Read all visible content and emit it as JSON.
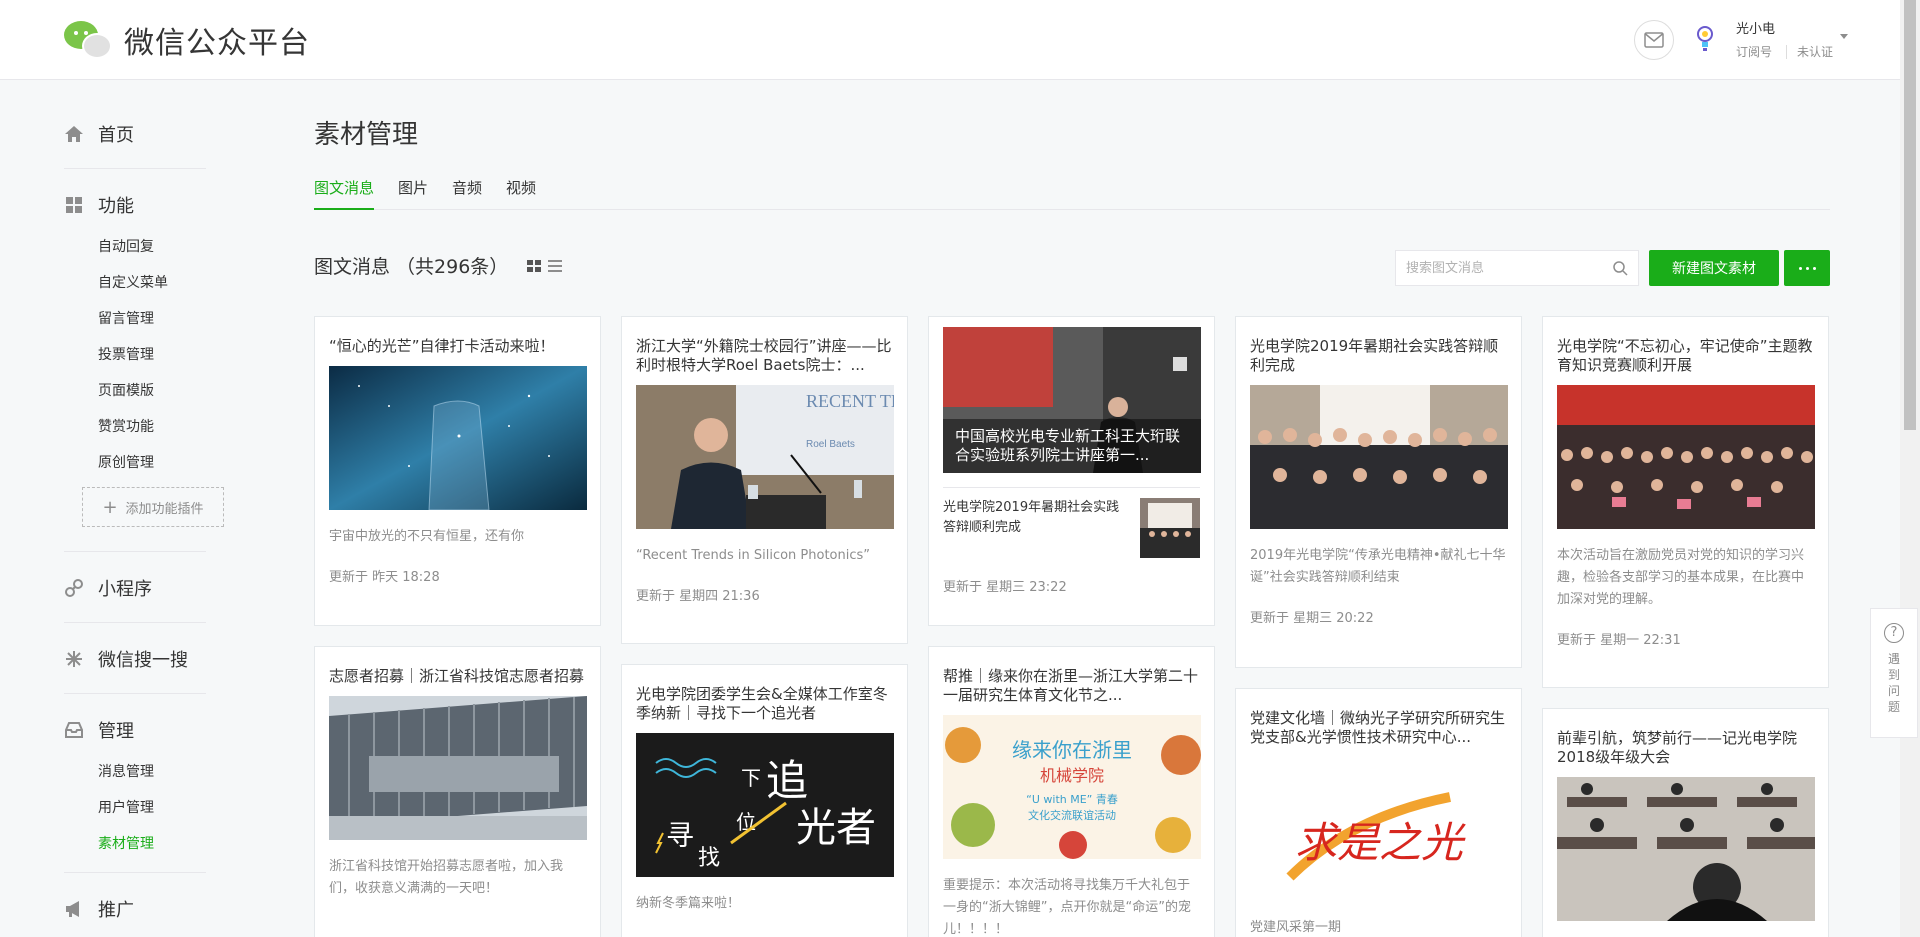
{
  "header": {
    "app_title": "微信公众平台",
    "account_name": "光小电",
    "account_type": "订阅号",
    "account_status": "未认证"
  },
  "sidebar": {
    "groups": [
      {
        "label": "首页",
        "icon": "home-icon",
        "items": []
      },
      {
        "label": "功能",
        "icon": "grid-icon",
        "items": [
          "自动回复",
          "自定义菜单",
          "留言管理",
          "投票管理",
          "页面模版",
          "赞赏功能",
          "原创管理"
        ],
        "add_plugin": "添加功能插件"
      },
      {
        "label": "小程序",
        "icon": "link-icon",
        "items": []
      },
      {
        "label": "微信搜一搜",
        "icon": "search-star-icon",
        "items": []
      },
      {
        "label": "管理",
        "icon": "inbox-icon",
        "items": [
          "消息管理",
          "用户管理",
          "素材管理"
        ]
      },
      {
        "label": "推广",
        "icon": "megaphone-icon",
        "items": []
      }
    ],
    "active_item": "素材管理"
  },
  "main": {
    "title": "素材管理",
    "tabs": [
      "图文消息",
      "图片",
      "音频",
      "视频"
    ],
    "active_tab": "图文消息",
    "list_title": "图文消息 （共296条）",
    "search_placeholder": "搜索图文消息",
    "new_button": "新建图文素材"
  },
  "cards": [
    {
      "title": "“恒心的光芒”自律打卡活动来啦！",
      "desc": "宇宙中放光的不只有恒星，还有你",
      "updated": "更新于 昨天 18:28"
    },
    {
      "title": "浙江大学“外籍院士校园行”讲座——比利时根特大学Roel Baets院士：...",
      "desc": "“Recent Trends in Silicon Photonics”",
      "updated": "更新于 星期四 21:36",
      "image_text": "RECENT TR",
      "image_text2": "Roel Baets"
    },
    {
      "title": "中国高校光电专业新工科王大珩联合实验班系列院士讲座第一...",
      "sub_title": "光电学院2019年暑期社会实践答辩顺利完成",
      "updated": "更新于 星期三 23:22"
    },
    {
      "title": "光电学院2019年暑期社会实践答辩顺利完成",
      "desc": "2019年光电学院“传承光电精神•献礼七十华诞”社会实践答辩顺利结束",
      "updated": "更新于 星期三 20:22"
    },
    {
      "title": "光电学院“不忘初心，牢记使命”主题教育知识竞赛顺利开展",
      "desc": "本次活动旨在激励党员对党的知识的学习兴趣，检验各支部学习的基本成果，在比赛中加深对党的理解。",
      "updated": "更新于 星期一 22:31"
    },
    {
      "title": "志愿者招募｜浙江省科技馆志愿者招募",
      "desc": "浙江省科技馆开始招募志愿者啦，加入我们，收获意义满满的一天吧！"
    },
    {
      "title": "光电学院团委学生会&全媒体工作室冬季纳新｜寻找下一个追光者",
      "desc": "纳新冬季篇来啦！",
      "poster": [
        "追",
        "光者",
        "寻",
        "找",
        "下",
        "位"
      ]
    },
    {
      "title": "帮推｜缘来你在浙里—浙江大学第二十一届研究生体育文化节之...",
      "desc": "重要提示：本次活动将寻找集万千大礼包于一身的“浙大锦鲤”，点开你就是“命运”的宠儿！！！！",
      "poster": [
        "缘来你在浙里",
        "机械学院",
        "“U with ME” 青春",
        "文化交流联谊活动"
      ]
    },
    {
      "title": "党建文化墙｜微纳光子学研究所研究生党支部&光学惯性技术研究中心...",
      "desc": "党建风采第一期",
      "poster": "求是之光"
    },
    {
      "title": "前辈引航，筑梦前行——记光电学院2018级年级大会"
    }
  ],
  "feedback": {
    "icon": "question-icon",
    "label": "遇到问题"
  },
  "colors": {
    "brand_green": "#1aad19",
    "text": "#353535",
    "muted": "#8d8d8d",
    "border": "#e7e7eb"
  }
}
